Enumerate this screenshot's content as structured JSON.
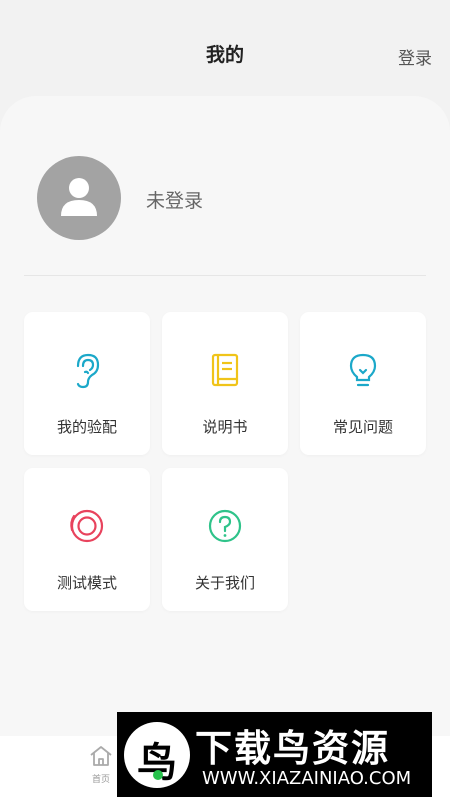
{
  "header": {
    "title": "我的",
    "login_label": "登录"
  },
  "profile": {
    "name": "未登录"
  },
  "menu": [
    {
      "label": "我的验配",
      "icon": "ear-icon",
      "color": "#1ba8c9"
    },
    {
      "label": "说明书",
      "icon": "book-icon",
      "color": "#f0c419"
    },
    {
      "label": "常见问题",
      "icon": "lightbulb-icon",
      "color": "#1ba8c9"
    },
    {
      "label": "测试模式",
      "icon": "target-icon",
      "color": "#e8435d"
    },
    {
      "label": "关于我们",
      "icon": "question-icon",
      "color": "#2fc38a"
    }
  ],
  "bottom_nav": {
    "home_label": "首页"
  },
  "watermark": {
    "title": "下载鸟资源",
    "url": "WWW.XIAZAINIAO.COM",
    "logo_char": "鸟"
  }
}
